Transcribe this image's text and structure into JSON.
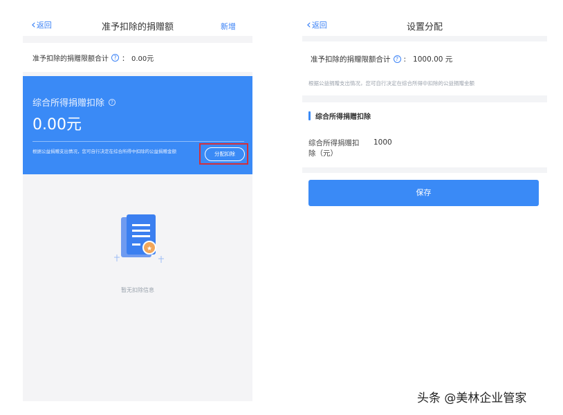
{
  "left": {
    "nav": {
      "back": "返回",
      "title": "准予扣除的捐赠额",
      "action": "新增"
    },
    "total": {
      "label": "准予扣除的捐赠限额合计",
      "sep": "：",
      "value": "0.00元"
    },
    "card": {
      "title": "综合所得捐赠扣除",
      "amount": "0.00元",
      "desc": "根据公益捐赠支出情况，您可自行决定在综合所得中扣除的公益捐赠金额",
      "button": "分配扣除"
    },
    "empty": {
      "text": "暂无扣除信息"
    }
  },
  "right": {
    "nav": {
      "back": "返回",
      "title": "设置分配"
    },
    "limit": {
      "label": "准予扣除的捐赠限额合计",
      "sep": ":",
      "value": "1000.00 元"
    },
    "desc": "根据公益捐赠支出情况，您可自行决定在综合所得中扣除的公益捐赠金额",
    "section": "综合所得捐赠扣除",
    "field": {
      "label": "综合所得捐赠扣除（元）",
      "value": "1000"
    },
    "save": "保存"
  },
  "watermark": "头条 @美林企业管家",
  "colors": {
    "accent": "#3a8af6",
    "highlight": "#d32f3a"
  },
  "icons": {
    "help": "question-circle-icon",
    "back": "chevron-left-icon",
    "empty": "document-badge-icon"
  }
}
